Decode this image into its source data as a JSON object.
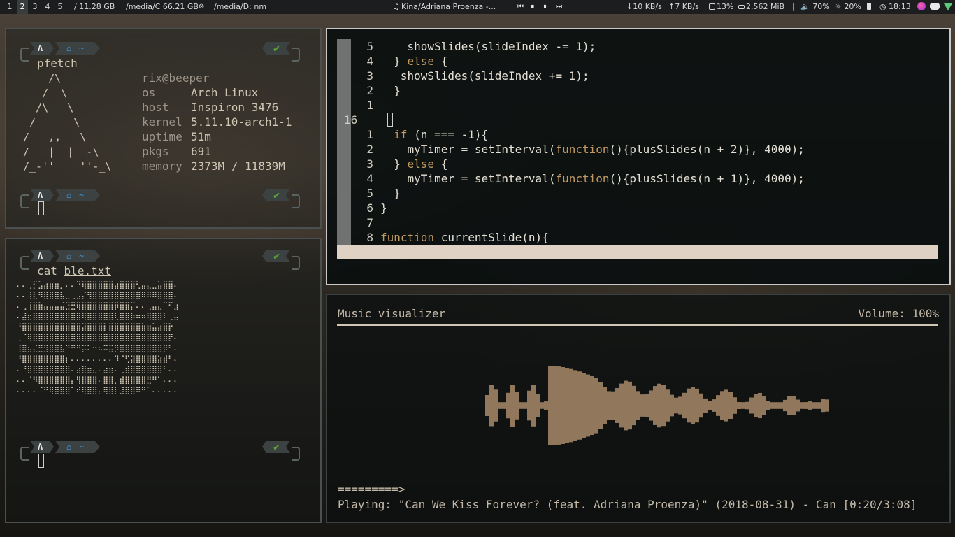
{
  "bar": {
    "workspaces": [
      "1",
      "2",
      "3",
      "4",
      "5"
    ],
    "active_workspace": "2",
    "disk_root": "/ 11.28 GB",
    "disk_c": "/media/C 66.21 GB",
    "disk_d": "/media/D: nm",
    "now_playing": "Kina/Adriana Proenza -...",
    "media_controls": [
      "⏮",
      "⏹",
      "⏸",
      "⏭"
    ],
    "down_speed": "↓10 KB/s",
    "up_speed": "↑7 KB/s",
    "cpu": "13%",
    "memory": "2,562 MiB",
    "separator": "|",
    "volume": "🔈 70%",
    "brightness": "☼ 20%",
    "battery_icon": "battery-icon",
    "clock": "18:13"
  },
  "term1": {
    "command": "pfetch",
    "logo": "    /\\\n   /  \\\n  /\\   \\\n /      \\\n/   ,,   \\\n/   |  |  -\\\n/_-''    ''-_\\",
    "user": "rix",
    "at": "@",
    "host": "beeper",
    "info": [
      {
        "key": "os",
        "value": "Arch Linux"
      },
      {
        "key": "host",
        "value": "Inspiron 3476"
      },
      {
        "key": "kernel",
        "value": "5.11.10-arch1-1"
      },
      {
        "key": "uptime",
        "value": "51m"
      },
      {
        "key": "pkgs",
        "value": "691"
      },
      {
        "key": "memory",
        "value": "2373M / 11839M"
      }
    ],
    "prompt_arch": "Λ",
    "prompt_home": "⌂",
    "prompt_tilde": "~",
    "prompt_ok": "✔"
  },
  "term2": {
    "command": "cat",
    "argument": "ble.txt",
    "art": [
      "⠄⠄⢀⡋⣡⣴⣶⣶⡀⠄⠄⠙⢿⣿⣿⣿⣿⣿⣴⣿⣿⣿⢃⣤⣄⣀⣥⣿⣿⠄",
      "⠄⠄⢸⣇⠻⣿⣿⣿⣧⣀⢀⣠⡌⢻⣿⣿⣿⣿⣿⣿⣿⣿⣿⠿⠿⠿⣿⣿⣿⠄",
      "⠄⢀⢸⣿⣷⣤⣤⣤⣬⣙⣛⢿⣿⣿⣿⣿⣿⣿⡿⣿⣿⡍⠄⠄⢀⣤⣄⠉⠋⣰",
      "⠄⣼⣖⣿⣿⣿⣿⣿⣿⣿⣿⣿⢿⣿⣿⣿⣿⣿⢇⣿⣿⡷⠶⠶⢿⣿⣿⠇⢀⣤",
      "⠘⣿⣿⣿⣿⣿⣿⣿⣿⣿⣿⣿⣽⣿⣿⣿⡇⣿⣿⣿⣿⣿⣿⣷⣶⣥⣴⣿⡗",
      "⢀⠈⢿⣿⣿⣿⣿⣿⣿⣿⣿⣿⣿⣿⣿⣿⣿⣿⣿⣿⣿⣿⣿⣿⣿⣿⣿⣿⡟⠄",
      "⢸⣿⣦⣌⣛⣻⣿⣿⣧⠙⠛⠛⡭⠅⠒⠦⠭⣭⡻⣿⣿⣿⣿⣿⣿⣿⣿⡿⠃⠄",
      "⠘⣿⣿⣿⣿⣿⣿⣿⣿⡆⠄⠄⠄⠄⠄⠄⠄⠄⠹⠈⢋⣽⣿⣿⣿⣿⣵⣾⠃⠄",
      "⠄⠘⣿⣿⣿⣿⣿⣿⣿⣿⠄⣴⣿⣶⣄⠄⣴⣶⠄⢀⣾⣿⣿⣿⣿⣿⣿⠃⠄⠄",
      "⠄⠄⠈⠻⣿⣿⣿⣿⣿⣿⡄⢻⣿⣿⣿⠄⣿⣿⡀⣾⣿⣿⣿⣿⣛⠛⠁⠄⠄⠄",
      "⠄⠄⠄⠄⠈⠛⢿⣿⣿⣿⠁⠞⢿⣿⣿⡄⢿⣿⡇⣸⣿⣿⠿⠛⠁⠄⠄⠄⠄⠄"
    ]
  },
  "editor": {
    "lines": [
      {
        "num": "5",
        "text": "    showSlides(slideIndex -= 1);"
      },
      {
        "num": "4",
        "text": "  } else {"
      },
      {
        "num": "3",
        "text": "   showSlides(slideIndex += 1);"
      },
      {
        "num": "2",
        "text": "  }"
      },
      {
        "num": "1",
        "text": ""
      },
      {
        "num": "16",
        "text": "",
        "current": true
      },
      {
        "num": "1",
        "text": "  if (n === -1){"
      },
      {
        "num": "2",
        "text": "    myTimer = setInterval(function(){plusSlides(n + 2)}, 4000);"
      },
      {
        "num": "3",
        "text": "  } else {"
      },
      {
        "num": "4",
        "text": "    myTimer = setInterval(function(){plusSlides(n + 1)}, 4000);"
      },
      {
        "num": "5",
        "text": "  }"
      },
      {
        "num": "6",
        "text": "}"
      },
      {
        "num": "7",
        "text": ""
      },
      {
        "num": "8",
        "text": "function currentSlide(n){"
      }
    ]
  },
  "music": {
    "title": "Music visualizer",
    "volume": "Volume: 100%",
    "progress_bar": "=========>",
    "playing": "Playing: \"Can We Kiss Forever? (feat. Adriana Proenza)\" (2018-08-31) - Can [0:20/3:08]",
    "progress": 0.106
  },
  "colors": {
    "accent_ok": "#5aa83a",
    "accent_home": "#3a8fd4",
    "wave": "#a88a68",
    "keyword": "#c29a62"
  }
}
